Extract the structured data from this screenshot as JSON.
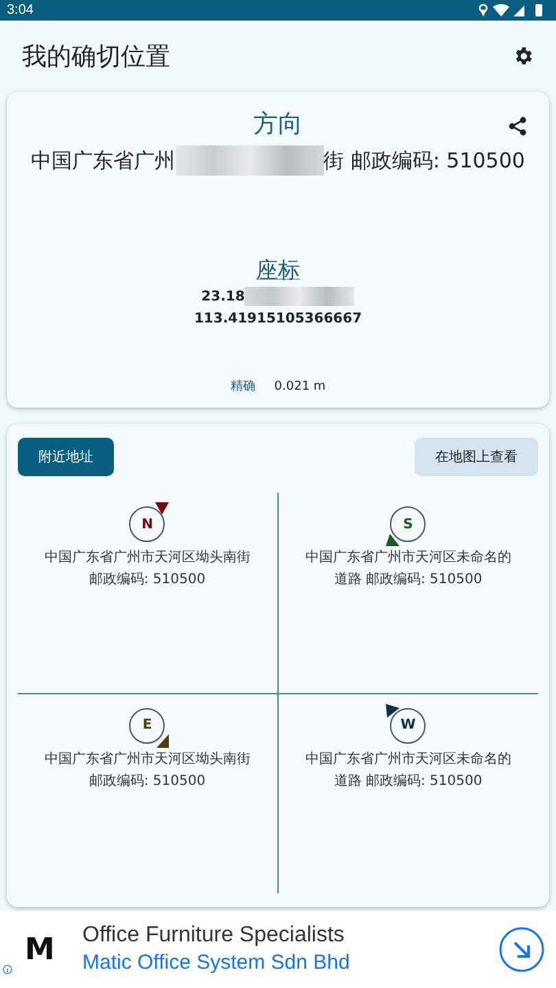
{
  "status_bar": {
    "time": "3:04"
  },
  "app_bar": {
    "title": "我的确切位置"
  },
  "location_card": {
    "heading": "方向",
    "address_prefix": "中国广东省广州",
    "address_suffix": "街 邮政编码: 510500",
    "coords_heading": "座标",
    "latitude": "23.18",
    "longitude": "113.41915105366667",
    "accuracy_label": "精确",
    "accuracy_value": "0.021 m"
  },
  "nearby": {
    "tabs": [
      {
        "label": "附近地址",
        "selected": true
      },
      {
        "label": "在地图上查看",
        "selected": false
      }
    ],
    "places": [
      {
        "letter": "N",
        "kind": "ne",
        "color": "#6b0f0f",
        "address_lines": [
          "中国广东省广州市天河区坳头南街",
          "邮政编码: 510500"
        ]
      },
      {
        "letter": "S",
        "kind": "sw",
        "color": "#1f5a1f",
        "address_lines": [
          "中国广东省广州市天河区未命名的",
          "道路 邮政编码: 510500"
        ]
      },
      {
        "letter": "E",
        "kind": "se",
        "color": "#4a3f10",
        "address_lines": [
          "中国广东省广州市天河区坳头南街",
          "邮政编码: 510500"
        ]
      },
      {
        "letter": "W",
        "kind": "nw",
        "color": "#12304a",
        "address_lines": [
          "中国广东省广州市天河区未命名的",
          "道路 邮政编码: 510500"
        ]
      }
    ]
  },
  "ad": {
    "logo": "M",
    "title": "Office Furniture Specialists",
    "subtitle": "Matic Office System Sdn Bhd"
  }
}
